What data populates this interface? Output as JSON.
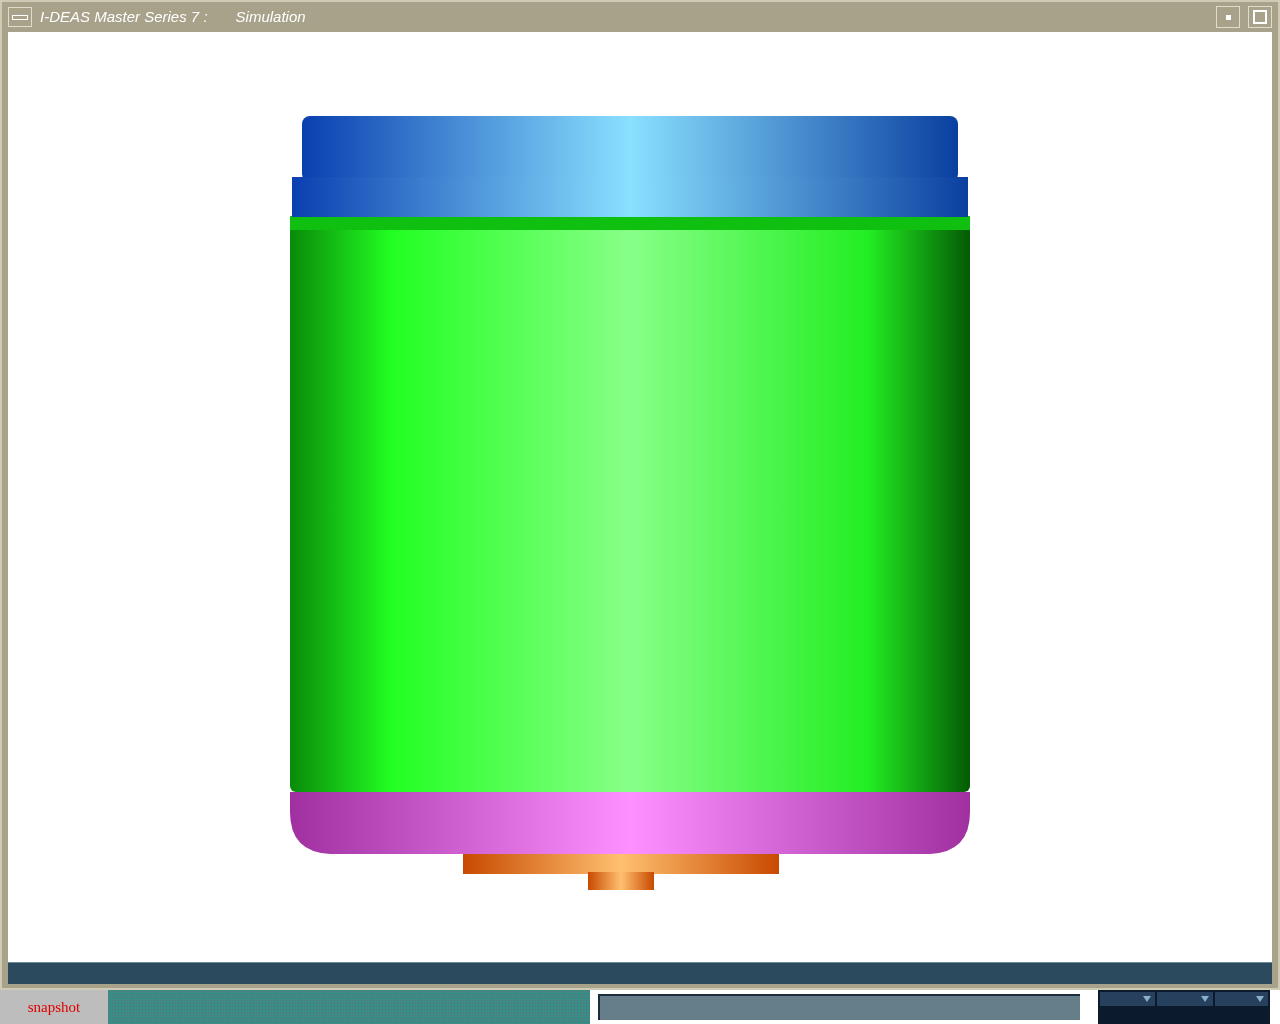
{
  "window": {
    "title": "I-DEAS Master Series 7 :",
    "subtitle": "Simulation"
  },
  "taskbar": {
    "button": "snapshot"
  }
}
